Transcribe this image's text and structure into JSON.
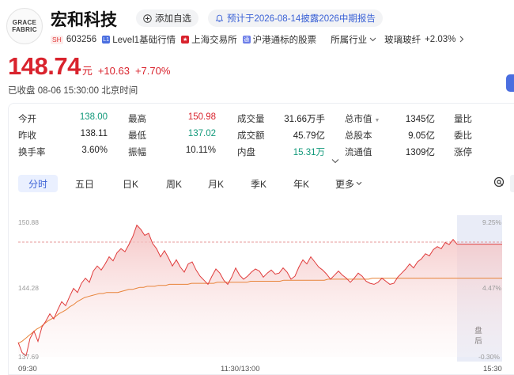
{
  "logo": {
    "line1": "GRACE",
    "line2": "FABRIC"
  },
  "stock": {
    "name": "宏和科技",
    "market": "SH",
    "code": "603256"
  },
  "actions": {
    "watch_icon": "plus-circle-icon",
    "watch": "添加自选",
    "notice_icon": "bell-icon",
    "notice": "预计于2026-08-14披露2026中期报告"
  },
  "subline": {
    "level1": "Level1基础行情",
    "exchange": "上海交易所",
    "connect": "沪港通标的股票",
    "industry_label": "所属行业",
    "industry": "玻璃玻纤",
    "industry_change": "+2.03%"
  },
  "quote": {
    "price": "148.74",
    "unit": "元",
    "change": "+10.63",
    "change_pct": "+7.70%",
    "status": "已收盘 08-06 15:30:00 北京时间"
  },
  "stats": {
    "open_label": "今开",
    "open": "138.00",
    "high_label": "最高",
    "high": "150.98",
    "volume_label": "成交量",
    "volume": "31.66万手",
    "mktcap_label": "总市值",
    "mktcap": "1345亿",
    "weibi_label": "量比",
    "prev_label": "昨收",
    "prev": "138.11",
    "low_label": "最低",
    "low": "137.02",
    "amount_label": "成交额",
    "amount": "45.79亿",
    "shares_label": "总股本",
    "shares": "9.05亿",
    "order_label": "委比",
    "turnover_label": "换手率",
    "turnover": "3.60%",
    "amplitude_label": "振幅",
    "amplitude": "10.11%",
    "inner_label": "内盘",
    "inner": "15.31万",
    "float_label": "流通值",
    "float": "1309亿",
    "limit_label": "涨停",
    "expand_icon": "chevron-down-icon"
  },
  "tabs": [
    "分时",
    "五日",
    "日K",
    "周K",
    "月K",
    "季K",
    "年K",
    "更多"
  ],
  "settings_icon": "settings-icon",
  "chart_data": {
    "type": "area",
    "y_left_ticks": [
      "150.88",
      "144.28",
      "137.69"
    ],
    "y_right_ticks": [
      "9.25%",
      "4.47%",
      "-0.30%"
    ],
    "x_ticks": [
      "09:30",
      "11:30/13:00",
      "15:30"
    ],
    "ylim": [
      137.69,
      150.88
    ],
    "prev_close": 138.11,
    "closed_label": "盘后",
    "colors": {
      "price": "#e03c3c",
      "avg": "#e8843a",
      "fill_top": "#f6cccc"
    },
    "series": [
      {
        "values": [
          139.1,
          138.1,
          137.8,
          139.5,
          140.2,
          139.2,
          140.6,
          141.2,
          141.9,
          141.4,
          142.3,
          143.1,
          142.7,
          143.6,
          144.4,
          144.0,
          144.9,
          145.4,
          145.0,
          146.1,
          146.6,
          146.2,
          146.8,
          147.5,
          147.1,
          147.9,
          148.3,
          148.0,
          148.7,
          149.5,
          150.6,
          150.2,
          149.6,
          149.8,
          148.8,
          148.3,
          147.5,
          148.1,
          147.4,
          146.6,
          147.2,
          146.5,
          146.0,
          146.8,
          147.0,
          146.2,
          145.6,
          145.2,
          144.8,
          145.6,
          146.3,
          145.9,
          145.2,
          144.8,
          145.5,
          146.4,
          145.7,
          145.3,
          145.6,
          146.0,
          146.3,
          146.1,
          145.5,
          145.9,
          146.2,
          145.8,
          145.9,
          146.4,
          146.0,
          145.3,
          145.6,
          146.5,
          147.2,
          146.8,
          147.5,
          147.0,
          146.5,
          146.2,
          145.8,
          145.3,
          145.7,
          146.1,
          145.7,
          145.4,
          145.0,
          145.4,
          145.9,
          145.6,
          145.1,
          144.9,
          144.8,
          145.0,
          145.4,
          145.1,
          144.8,
          144.9,
          145.5,
          145.9,
          146.3,
          146.8,
          146.4,
          147.0,
          147.3,
          147.8,
          147.6,
          148.2,
          148.5,
          148.3,
          148.9,
          148.7,
          149.2,
          148.74
        ]
      },
      {
        "values": [
          139.0,
          139.2,
          139.5,
          139.8,
          140.1,
          140.4,
          140.6,
          140.9,
          141.2,
          141.4,
          141.6,
          141.9,
          142.1,
          142.3,
          142.6,
          142.8,
          143.1,
          143.3,
          143.5,
          143.6,
          143.7,
          143.8,
          143.9,
          143.9,
          144.0,
          144.0,
          144.0,
          144.0,
          144.1,
          144.2,
          144.3,
          144.3,
          144.4,
          144.5,
          144.5,
          144.6,
          144.6,
          144.6,
          144.7,
          144.7,
          144.7,
          144.8,
          144.8,
          144.8,
          144.8,
          144.8,
          144.8,
          144.9,
          144.9,
          144.9,
          144.9,
          144.9,
          144.9,
          144.9,
          145.0,
          145.0,
          145.0,
          145.0,
          145.0,
          145.0,
          145.0,
          145.0,
          145.0,
          145.1,
          145.1,
          145.1,
          145.1,
          145.1,
          145.1,
          145.1,
          145.1,
          145.1,
          145.2,
          145.2,
          145.2,
          145.2,
          145.2,
          145.2,
          145.2,
          145.2,
          145.2,
          145.2,
          145.2,
          145.2,
          145.3,
          145.3,
          145.3,
          145.3,
          145.3,
          145.3,
          145.3,
          145.3,
          145.3,
          145.3,
          145.3,
          145.3,
          145.4,
          145.4,
          145.4,
          145.4,
          145.4,
          145.4,
          145.4,
          145.4,
          145.4,
          145.4,
          145.4,
          145.4,
          145.4,
          145.4,
          145.4,
          145.4,
          145.4,
          145.4,
          145.4,
          145.4,
          145.4,
          145.4,
          145.4,
          145.4
        ]
      }
    ]
  }
}
